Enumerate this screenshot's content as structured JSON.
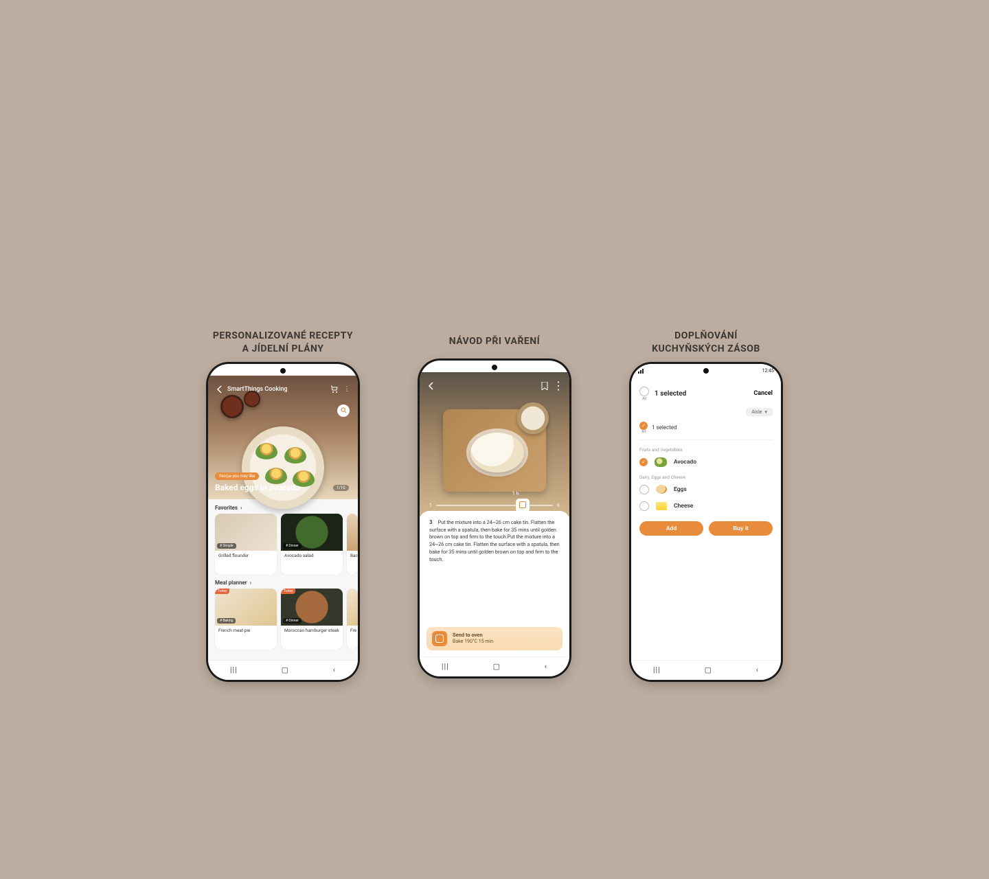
{
  "status_time": "12:45",
  "captions": {
    "c1": "PERSONALIZOVANÉ RECEPTY\nA JÍDELNÍ PLÁNY",
    "c2": "NÁVOD PŘI VAŘENÍ",
    "c3": "DOPLŇOVÁNÍ\nKUCHYŇSKÝCH ZÁSOB"
  },
  "phone1": {
    "app_title": "SmartThings Cooking",
    "hero": {
      "chip": "Recipe you may like",
      "recipe_name": "Baked eggs in avocado",
      "page_indicator": "1/10"
    },
    "section_favorites": "Favorites",
    "section_mealplanner": "Meal planner",
    "today_tag": "Today",
    "favorites": [
      {
        "tag": "# Simple",
        "label": "Grilled flounder"
      },
      {
        "tag": "# Dinner",
        "label": "Avocado salad"
      },
      {
        "tag": "#",
        "label": "Bac"
      }
    ],
    "meals": [
      {
        "tag": "# Baking",
        "label": "French meat pie"
      },
      {
        "tag": "# Dinner",
        "label": "Moroccan hamburger steak"
      },
      {
        "tag": "#",
        "label": "Fre"
      }
    ]
  },
  "phone2": {
    "slider": {
      "start": "1",
      "end": "6",
      "current_label": "1 h"
    },
    "step_number": "3",
    "step_text": "Put the mixture into a 24~26 cm cake tin. Flatten the surface with a spatula, then bake for 35 mins until golden brown on top and firm to the touch.Put the mixture into a 24~26 cm cake tin. Flatten the surface with a spatula, then bake for 35 mins until golden brown on top and firm to the touch.",
    "send": {
      "title": "Send to oven",
      "detail": "Bake 190°C    15 min"
    }
  },
  "phone3": {
    "selected_header": "1 selected",
    "cancel": "Cancel",
    "aisle": "Aisle",
    "selected_sub": "1 selected",
    "all": "All",
    "group_fruits": "Fruits and Vegetables",
    "group_dairy": "Dairy, Eggs and Cheese",
    "items": {
      "avocado": "Avocado",
      "eggs": "Eggs",
      "cheese": "Cheese"
    },
    "buttons": {
      "add": "Add",
      "buy": "Buy it"
    }
  }
}
